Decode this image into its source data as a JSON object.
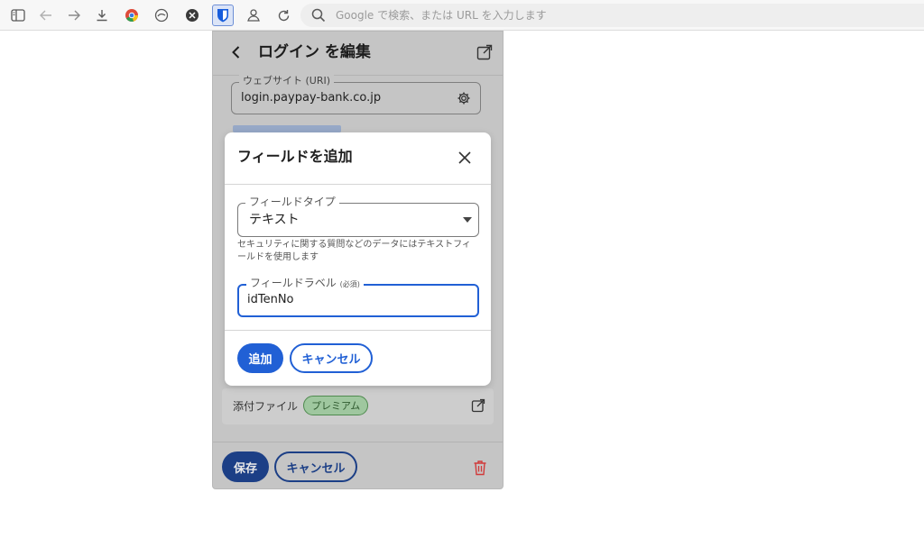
{
  "browser": {
    "toolbar_icons": [
      "sidebar-icon",
      "back-arrow-icon",
      "forward-arrow-icon",
      "download-icon",
      "chrome-icon",
      "extension-icon",
      "extension-x-icon",
      "bitwarden-icon",
      "profile-icon",
      "reload-icon"
    ],
    "address_placeholder": "Google で検索、または URL を入力します"
  },
  "popup": {
    "title": "ログイン を編集",
    "uri_label": "ウェブサイト (URI)",
    "uri_value": "login.paypay-bank.co.jp",
    "attachments_label": "添付ファイル",
    "premium_badge": "プレミアム",
    "save_label": "保存",
    "cancel_label": "キャンセル"
  },
  "dialog": {
    "title": "フィールドを追加",
    "field_type_label": "フィールドタイプ",
    "field_type_value": "テキスト",
    "help_text": "セキュリティに関する質問などのデータにはテキストフィールドを使用します",
    "field_label_label": "フィールドラベル",
    "field_label_required": "(必須)",
    "field_label_value": "idTenNo",
    "add_label": "追加",
    "cancel_label": "キャンセル"
  },
  "colors": {
    "primary": "#2160d5",
    "primary_dimmed": "#1c3f86",
    "danger": "#d13a3a",
    "premium": "#4e8a4e"
  }
}
